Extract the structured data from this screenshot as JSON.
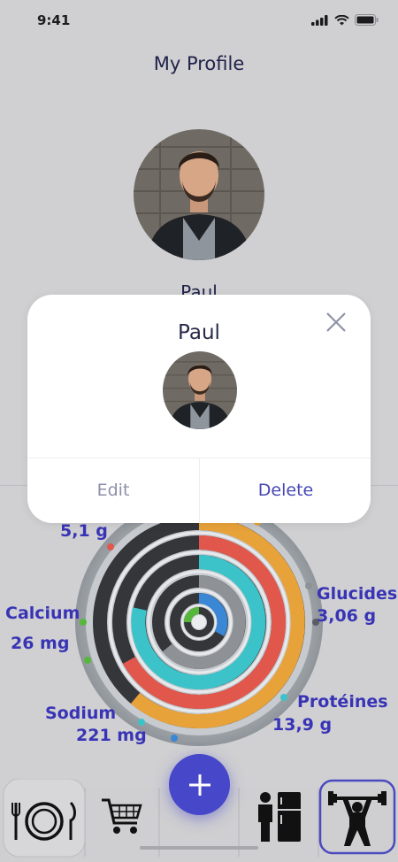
{
  "status": {
    "time": "9:41"
  },
  "header": {
    "title": "My Profile"
  },
  "profile": {
    "name": "Paul"
  },
  "nutrients": {
    "top_left_value": "5,1 g",
    "calcium_label": "Calcium",
    "calcium_value": "26 mg",
    "glucides_label": "Glucides",
    "glucides_value": "3,06 g",
    "sodium_label": "Sodium",
    "sodium_value": "221 mg",
    "proteines_label": "Protéines",
    "proteines_value": "13,9 g"
  },
  "modal": {
    "name": "Paul",
    "edit_label": "Edit",
    "delete_label": "Delete"
  },
  "tabs": [
    {
      "icon": "plate-cutlery-icon"
    },
    {
      "icon": "shopping-cart-icon"
    },
    {
      "icon": "fridge-person-icon"
    },
    {
      "icon": "weightlifter-icon"
    }
  ],
  "colors": {
    "accent": "#4747c9",
    "label_text": "#3834b5",
    "ring_orange": "#e8a23a",
    "ring_red": "#e2574c",
    "ring_teal": "#3cc3c9",
    "ring_blue": "#3a87d6",
    "ring_green": "#56b83a"
  }
}
